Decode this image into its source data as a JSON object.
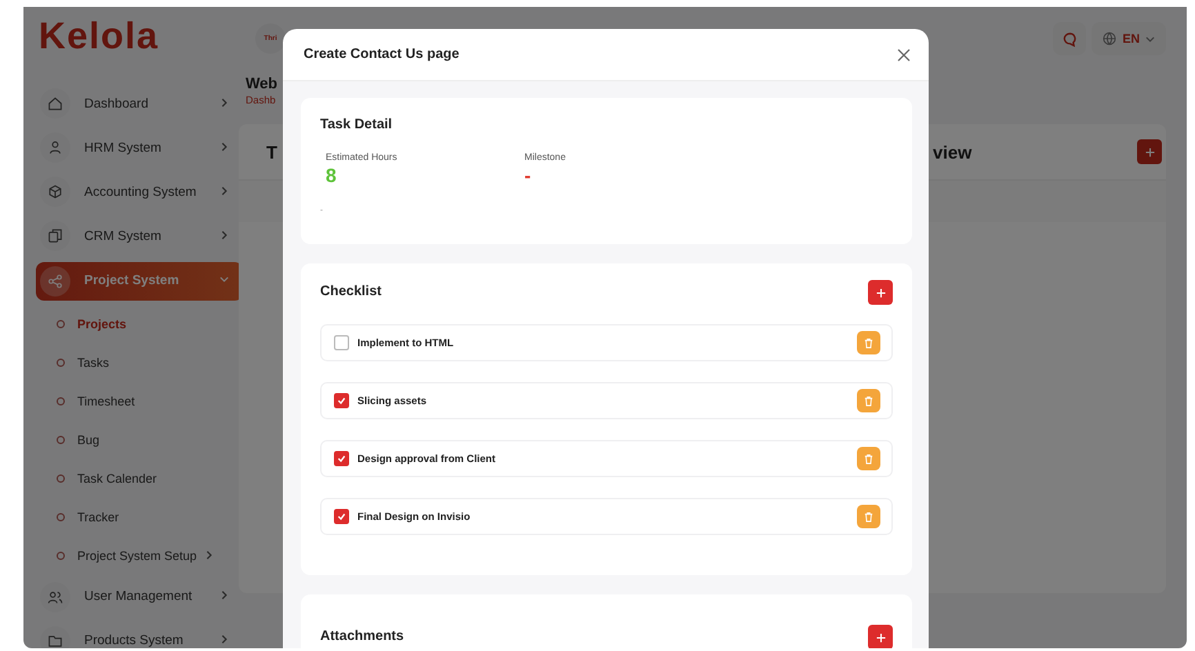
{
  "logo": "Kelola",
  "header": {
    "company_badge": "Thri",
    "language": "EN"
  },
  "sidebar": {
    "items": [
      {
        "label": "Dashboard",
        "selected": false,
        "expanded": false
      },
      {
        "label": "HRM System",
        "selected": false,
        "expanded": false
      },
      {
        "label": "Accounting System",
        "selected": false,
        "expanded": false
      },
      {
        "label": "CRM System",
        "selected": false,
        "expanded": false
      },
      {
        "label": "Project System",
        "selected": true,
        "expanded": true,
        "children": [
          {
            "label": "Projects",
            "selected": true
          },
          {
            "label": "Tasks",
            "selected": false
          },
          {
            "label": "Timesheet",
            "selected": false
          },
          {
            "label": "Bug",
            "selected": false
          },
          {
            "label": "Task Calender",
            "selected": false
          },
          {
            "label": "Tracker",
            "selected": false
          },
          {
            "label": "Project System Setup",
            "selected": false,
            "expanded": false
          }
        ]
      },
      {
        "label": "User Management",
        "selected": false,
        "expanded": false
      },
      {
        "label": "Products System",
        "selected": false,
        "expanded": false
      }
    ]
  },
  "page": {
    "title": "Web",
    "breadcrumb": "Dashb",
    "card_title_left": "T",
    "card_title_right": "view"
  },
  "modal": {
    "title": "Create Contact Us page",
    "task_detail": {
      "heading": "Task Detail",
      "fields": [
        {
          "label": "Estimated Hours",
          "value": "8",
          "kind": "hours"
        },
        {
          "label": "Milestone",
          "value": "-",
          "kind": "milestone"
        }
      ],
      "description": "-"
    },
    "checklist": {
      "heading": "Checklist",
      "items": [
        {
          "label": "Implement to HTML",
          "checked": false
        },
        {
          "label": "Slicing assets",
          "checked": true
        },
        {
          "label": "Design approval from Client",
          "checked": true
        },
        {
          "label": "Final Design on Invisio",
          "checked": true
        }
      ]
    },
    "attachments": {
      "heading": "Attachments"
    }
  }
}
